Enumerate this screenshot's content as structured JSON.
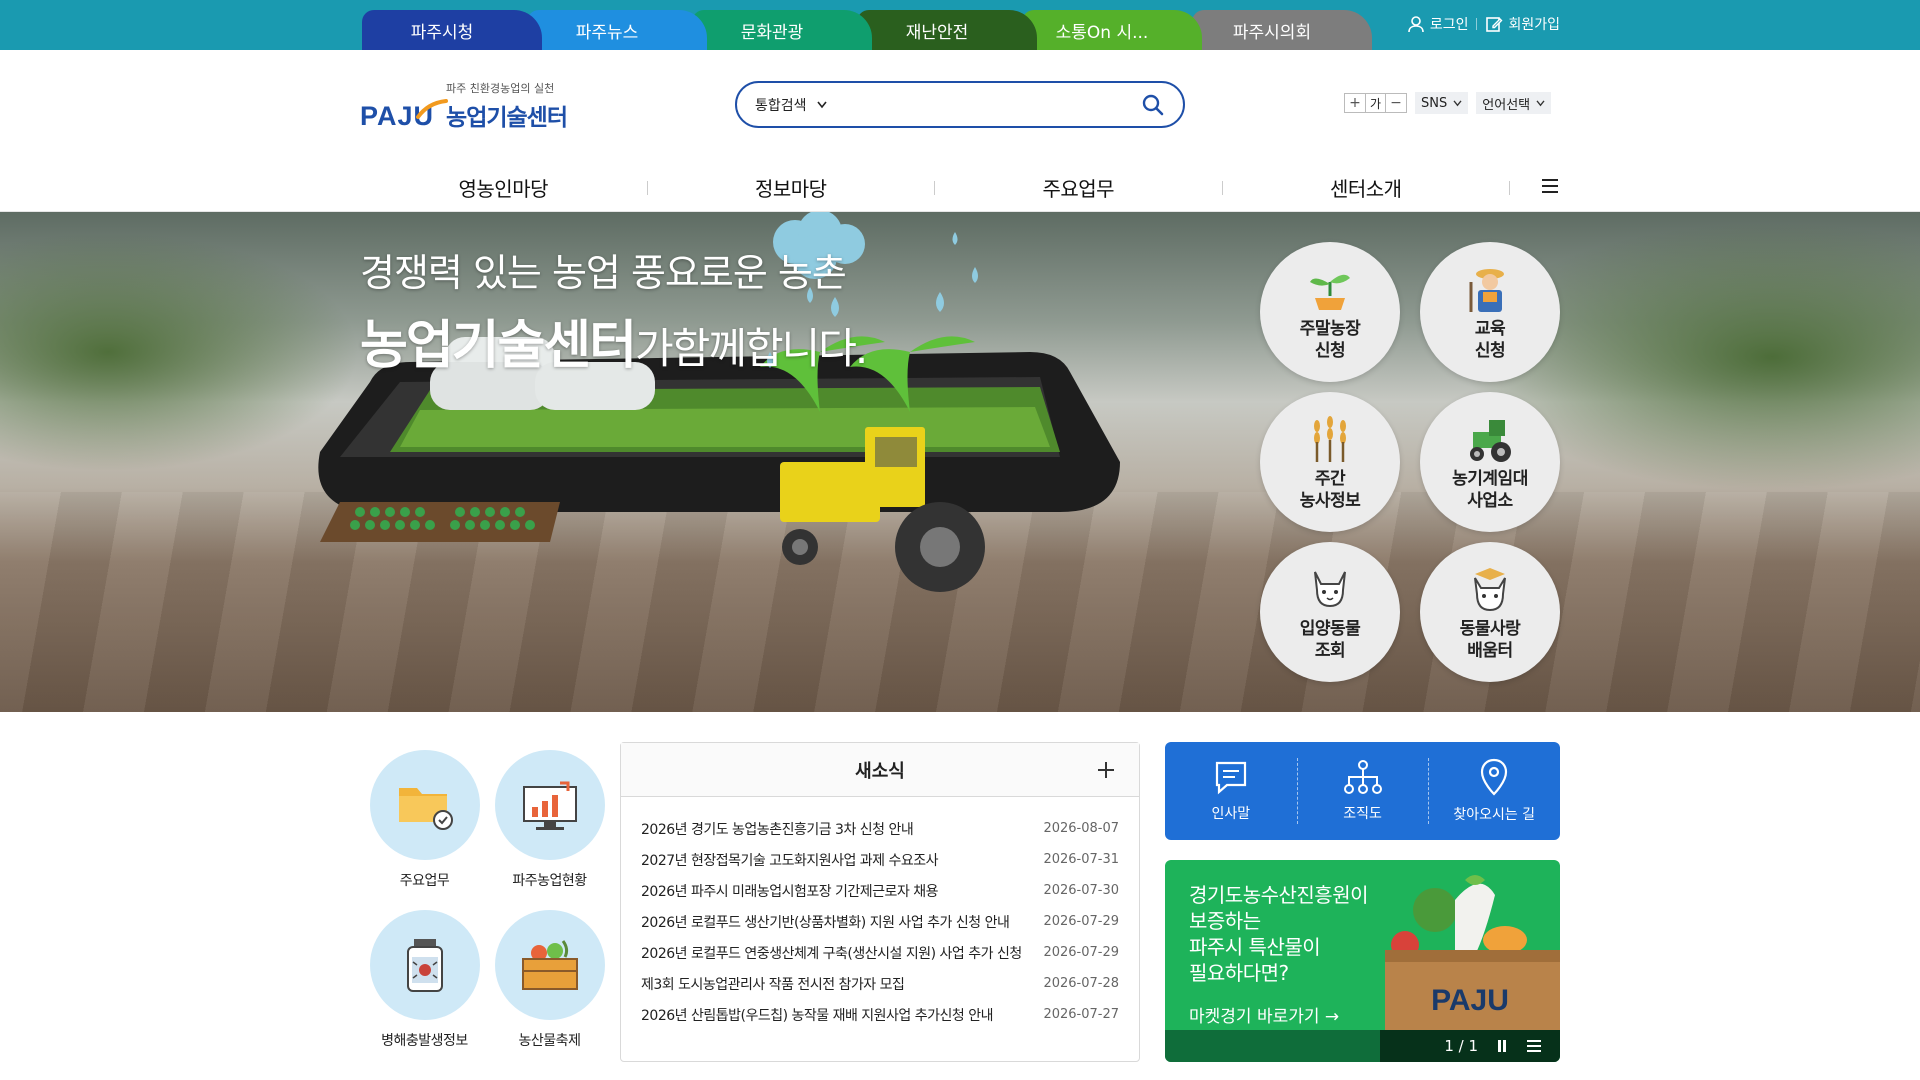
{
  "top_tabs": [
    {
      "label": "파주시청",
      "color": "#1e3fa3"
    },
    {
      "label": "파주뉴스",
      "color": "#1f8fe0"
    },
    {
      "label": "문화관광",
      "color": "#0f9e6e"
    },
    {
      "label": "재난안전",
      "color": "#2a5f1e"
    },
    {
      "label": "소통On 시...",
      "color": "#55b02a"
    },
    {
      "label": "파주시의회",
      "color": "#7d7d7d"
    }
  ],
  "top_util": {
    "login": "로그인",
    "join": "회원가입"
  },
  "logo": {
    "mark": "PAJU",
    "slogan": "파주 친환경농업의 실천",
    "name": "농업기술센터"
  },
  "search": {
    "scope": "통합검색",
    "value": "",
    "placeholder": ""
  },
  "header_tools": {
    "font_label": "가",
    "sns": "SNS",
    "language": "언어선택"
  },
  "gnb": [
    "영농인마당",
    "정보마당",
    "주요업무",
    "센터소개"
  ],
  "hero": {
    "line1": "경쟁력 있는 농업 풍요로운 농촌",
    "line2_bold": "농업기술센터",
    "line2_rest": "가함께합니다."
  },
  "quick_circles": [
    {
      "label": "주말농장\n신청",
      "icon": "sprout-icon"
    },
    {
      "label": "교육\n신청",
      "icon": "farmer-icon"
    },
    {
      "label": "주간\n농사정보",
      "icon": "wheat-icon"
    },
    {
      "label": "농기계임대\n사업소",
      "icon": "tractor-icon"
    },
    {
      "label": "입양동물\n조회",
      "icon": "cat-icon"
    },
    {
      "label": "동물사랑\n배움터",
      "icon": "graduate-cat-icon"
    }
  ],
  "quick_tiles": [
    {
      "label": "주요업무",
      "icon": "folder-check-icon"
    },
    {
      "label": "파주농업현황",
      "icon": "chart-monitor-icon"
    },
    {
      "label": "병해충발생정보",
      "icon": "bug-jar-icon"
    },
    {
      "label": "농산물축제",
      "icon": "produce-box-icon"
    }
  ],
  "news": {
    "title": "새소식",
    "items": [
      {
        "title": "2026년 경기도 농업농촌진흥기금 3차 신청 안내",
        "date": "2026-08-07"
      },
      {
        "title": "2027년 현장접목기술 고도화지원사업 과제 수요조사",
        "date": "2026-07-31"
      },
      {
        "title": "2026년 파주시 미래농업시험포장 기간제근로자 채용",
        "date": "2026-07-30"
      },
      {
        "title": "2026년 로컬푸드 생산기반(상품차별화) 지원 사업 추가 신청 안내",
        "date": "2026-07-29"
      },
      {
        "title": "2026년 로컬푸드 연중생산체계 구축(생산시설 지원) 사업 추가 신청",
        "date": "2026-07-29"
      },
      {
        "title": "제3회 도시농업관리사 작품 전시전 참가자 모집",
        "date": "2026-07-28"
      },
      {
        "title": "2026년 산림톱밥(우드칩) 농작물 재배 지원사업 추가신청 안내",
        "date": "2026-07-27"
      }
    ]
  },
  "info_links": [
    {
      "label": "인사말",
      "icon": "speech-icon"
    },
    {
      "label": "조직도",
      "icon": "org-chart-icon"
    },
    {
      "label": "찾아오시는 길",
      "icon": "location-pin-icon"
    }
  ],
  "banner": {
    "text": "경기도농수산진흥원이\n보증하는\n파주시 특산물이\n필요하다면?",
    "link": "마켓경기 바로가기 →",
    "box_label": "PAJU",
    "pager": "1 / 1"
  }
}
